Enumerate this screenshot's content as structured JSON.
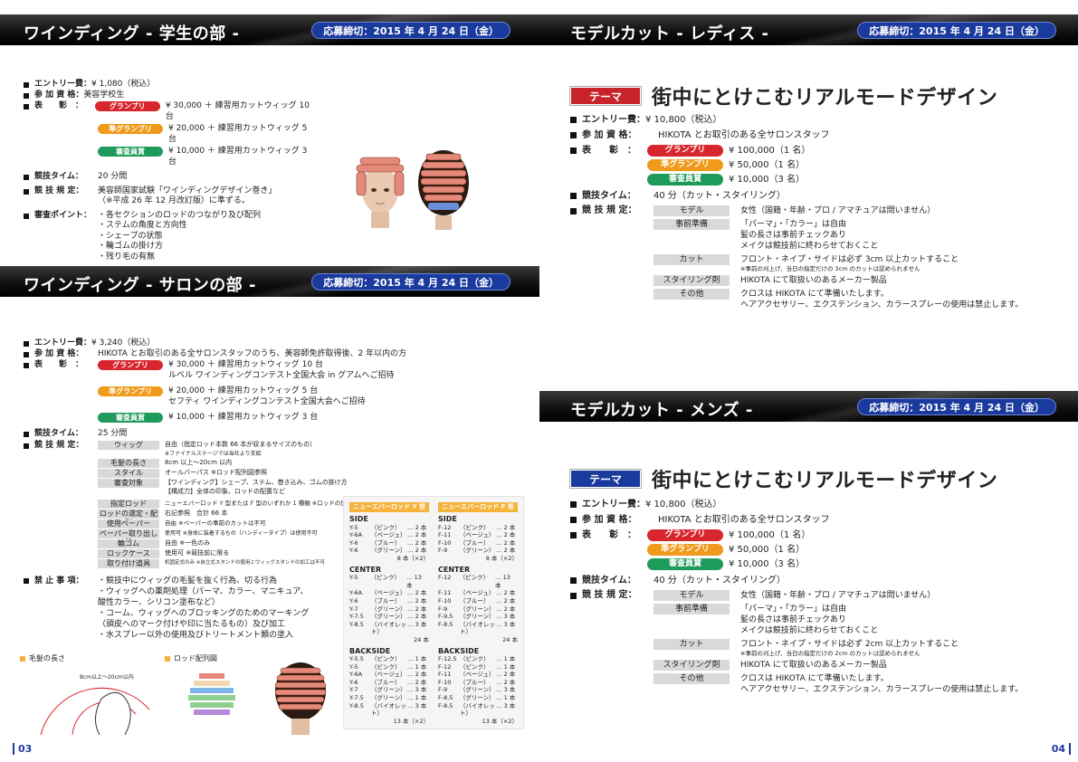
{
  "colors": {
    "grand": "#d8262e",
    "jun": "#f09a1c",
    "shinsa": "#1e9a5a",
    "deadline": "#1b3a9e",
    "theme_red": "#c8222a",
    "theme_blue": "#1b3a9e"
  },
  "deadline": "応募締切：2015 年 4 月 24 日（金）",
  "awards": {
    "grand": "グランプリ",
    "jun": "準グランプリ",
    "shinsa": "審査員賞"
  },
  "labels": {
    "entry": "エントリー費：",
    "qual": "参 加 資 格：",
    "award": "表　　彰　：",
    "time": "競技タイム：",
    "rules": "競 技 規 定：",
    "points": "審査ポイント：",
    "prohibit": "禁 止 事 項："
  },
  "student": {
    "title": "ワインディング - 学生の部 -",
    "entry": "¥ 1,080（税込）",
    "qual": "美容学校生",
    "prizes": [
      "¥ 30,000 ＋ 練習用カットウィッグ 10 台",
      "¥ 20,000 ＋ 練習用カットウィッグ 5 台",
      "¥ 10,000 ＋ 練習用カットウィッグ 3 台"
    ],
    "time": "20 分間",
    "rules": [
      "美容師国家試験「ワインディングデザイン巻き」",
      "（※平成 26 年 12 月改訂版）に準ずる。"
    ],
    "points": [
      "・各セクションのロッドのつながり及び配列",
      "・ステムの角度と方向性",
      "・シェープの状態",
      "・輪ゴムの掛け方",
      "・残り毛の有無"
    ]
  },
  "salon": {
    "title": "ワインディング - サロンの部 -",
    "entry": "¥ 3,240（税込）",
    "qual": "HIKOTA とお取引のある全サロンスタッフのうち、美容師免許取得後、2 年以内の方",
    "prize1": [
      "¥ 30,000 ＋ 練習用カットウィッグ 10 台",
      "ルベル ワインディングコンテスト全国大会 in グアムへご招待"
    ],
    "prize2": [
      "¥ 20,000 ＋ 練習用カットウィッグ 5 台",
      "セフティ ワインディングコンテスト全国大会へご招待"
    ],
    "prize3": "¥ 10,000 ＋ 練習用カットウィッグ 3 台",
    "time": "25 分間",
    "rules": [
      {
        "k": "ウィッグ",
        "v": "自由（指定ロッド本数 66 本が収まるサイズのもの）",
        "n": "※ファイナルステージでは当社より支給"
      },
      {
        "k": "毛髪の長さ",
        "v": "8cm 以上〜20cm 以内",
        "n": ""
      },
      {
        "k": "スタイル",
        "v": "オールバーパス ※ロッド配列図参照",
        "n": ""
      },
      {
        "k": "審査対象",
        "v": "【ワインディング】シェープ、ステム、巻き込み、ゴムの掛け方",
        "n": "【構成力】全体の印象、ロッドの配置など"
      },
      {
        "k": "指定ロッド",
        "v": "ニューエバーロッド Y 型または F 型のいずれか 1 種類 ※ロッドの加工禁止",
        "n": ""
      },
      {
        "k": "ロッドの選定・配列",
        "v": "右記参照　合計 66 本",
        "n": ""
      },
      {
        "k": "使用ペーパー",
        "v": "自由 ※ペーパーの事前のカットは不可",
        "n": ""
      },
      {
        "k": "ペーパー取り出し器",
        "v": "使用可 ※身体に装着するもの（ハンディータイプ）は使用不可",
        "n": ""
      },
      {
        "k": "輪ゴム",
        "v": "自由 ※一色のみ",
        "n": ""
      },
      {
        "k": "ロックケース",
        "v": "使用可 ※競技前に限る",
        "n": ""
      },
      {
        "k": "取り付け道具",
        "v": "机固定式のみ ※自立式スタンドの使用とウィッグスタンドの加工は不可",
        "n": ""
      }
    ],
    "prohibit": [
      "・競技中にウィッグの毛髪を抜く行為、切る行為",
      "・ウィッグへの薬剤処理（パーマ、カラー、マニキュア、",
      "酸性カラー、シリコン塗布など）",
      "・コーム、ウィッグへのブロッキングのためのマーキング",
      "（頭皮へのマーク付けや印に当たるもの）及び加工",
      "・水スプレー以外の使用及びトリートメント類の塗入"
    ],
    "fig1": "毛髪の長さ",
    "fig1_text": "8cm以上〜20cm以内",
    "fig2": "ロッド配列図"
  },
  "rods": {
    "y": {
      "title": "ニューエバーロッド Y 型",
      "side": [
        [
          "Y-5",
          "（ピンク）",
          "… 2 本"
        ],
        [
          "Y-6A",
          "（ベージュ）",
          "… 2 本"
        ],
        [
          "Y-6",
          "（ブルー）",
          "… 2 本"
        ],
        [
          "Y-6",
          "（グリーン）",
          "… 2 本"
        ]
      ],
      "side_total": "8 本（×2）",
      "center": [
        [
          "Y-5",
          "（ピンク）",
          "… 13 本"
        ],
        [
          "Y-6A",
          "（ベージュ）",
          "… 2 本"
        ],
        [
          "Y-6",
          "（ブルー）",
          "… 2 本"
        ],
        [
          "Y-7",
          "（グリーン）",
          "… 2 本"
        ],
        [
          "Y-7.5",
          "（グリーン）",
          "… 2 本"
        ],
        [
          "Y-8.5",
          "（バイオレット）",
          "… 3 本"
        ]
      ],
      "center_total": "24 本",
      "back": [
        [
          "Y-5.5",
          "（ピンク）",
          "… 1 本"
        ],
        [
          "Y-5",
          "（ピンク）",
          "… 1 本"
        ],
        [
          "Y-6A",
          "（ベージュ）",
          "… 2 本"
        ],
        [
          "Y-6",
          "（ブルー）",
          "… 2 本"
        ],
        [
          "Y-7",
          "（グリーン）",
          "… 3 本"
        ],
        [
          "Y-7.5",
          "（グリーン）",
          "… 1 本"
        ],
        [
          "Y-8.5",
          "（バイオレット）",
          "… 3 本"
        ]
      ],
      "back_total": "13 本（×2）"
    },
    "f": {
      "title": "ニューエバーロッド F 型",
      "side": [
        [
          "F-12",
          "（ピンク）",
          "… 2 本"
        ],
        [
          "F-11",
          "（ベージュ）",
          "… 2 本"
        ],
        [
          "F-10",
          "（ブルー）",
          "… 2 本"
        ],
        [
          "F-9",
          "（グリーン）",
          "… 2 本"
        ]
      ],
      "side_total": "8 本（×2）",
      "center": [
        [
          "F-12",
          "（ピンク）",
          "… 13 本"
        ],
        [
          "F-11",
          "（ベージュ）",
          "… 2 本"
        ],
        [
          "F-10",
          "（ブルー）",
          "… 2 本"
        ],
        [
          "F-9",
          "（グリーン）",
          "… 2 本"
        ],
        [
          "F-9.5",
          "（グリーン）",
          "… 3 本"
        ],
        [
          "F-8.5",
          "（バイオレット）",
          "… 3 本"
        ]
      ],
      "center_total": "24 本",
      "back": [
        [
          "F-12.5",
          "（ピンク）",
          "… 1 本"
        ],
        [
          "F-12",
          "（ピンク）",
          "… 1 本"
        ],
        [
          "F-11",
          "（ベージュ）",
          "… 2 本"
        ],
        [
          "F-10",
          "（ブルー）",
          "… 2 本"
        ],
        [
          "F-9",
          "（グリーン）",
          "… 3 本"
        ],
        [
          "F-8.5",
          "（グリーン）",
          "… 1 本"
        ],
        [
          "F-8.5",
          "（バイオレット）",
          "… 3 本"
        ]
      ],
      "back_total": "13 本（×2）"
    },
    "side": "SIDE",
    "center": "CENTER",
    "back": "BACKSIDE"
  },
  "ladies": {
    "title": "モデルカット - レディス -",
    "theme_tag": "テーマ",
    "theme": "街中にとけこむリアルモードデザイン",
    "entry": "¥ 10,800（税込）",
    "qual": "HIKOTA とお取引のある全サロンスタッフ",
    "prizes": [
      "¥ 100,000（1 名）",
      "¥ 50,000（1 名）",
      "¥ 10,000（3 名）"
    ],
    "time": "40 分（カット・スタイリング）",
    "rules": [
      {
        "k": "モデル",
        "v": [
          "女性（国籍・年齢・プロ / アマチュアは問いません）"
        ]
      },
      {
        "k": "事前準備",
        "v": [
          "「パーマ」・「カラー」は自由",
          "髪の長さは事前チェックあり",
          "メイクは競技前に終わらせておくこと"
        ]
      },
      {
        "k": "カット",
        "v": [
          "フロント・ネイプ・サイドは必ず 3cm 以上カットすること"
        ],
        "n": "※事前の刈上げ、当日の指定だけの 3cm のカットは認められません"
      },
      {
        "k": "スタイリング剤",
        "v": [
          "HIKOTA にて取扱いのあるメーカー製品"
        ]
      },
      {
        "k": "その他",
        "v": [
          "クロスは HIKOTA にて準備いたします。",
          "ヘアアクセサリー、エクステンション、カラースプレーの使用は禁止します。"
        ]
      }
    ]
  },
  "mens": {
    "title": "モデルカット - メンズ -",
    "theme_tag": "テーマ",
    "theme": "街中にとけこむリアルモードデザイン",
    "entry": "¥ 10,800（税込）",
    "qual": "HIKOTA とお取引のある全サロンスタッフ",
    "prizes": [
      "¥ 100,000（1 名）",
      "¥ 50,000（1 名）",
      "¥ 10,000（3 名）"
    ],
    "time": "40 分（カット・スタイリング）",
    "rules": [
      {
        "k": "モデル",
        "v": [
          "女性（国籍・年齢・プロ / アマチュアは問いません）"
        ]
      },
      {
        "k": "事前準備",
        "v": [
          "「パーマ」・「カラー」は自由",
          "髪の長さは事前チェックあり",
          "メイクは競技前に終わらせておくこと"
        ]
      },
      {
        "k": "カット",
        "v": [
          "フロント・ネイプ・サイドは必ず 2cm 以上カットすること"
        ],
        "n": "※事前の刈上げ、当日の指定だけの 2cm のカットは認められません"
      },
      {
        "k": "スタイリング剤",
        "v": [
          "HIKOTA にて取扱いのあるメーカー製品"
        ]
      },
      {
        "k": "その他",
        "v": [
          "クロスは HIKOTA にて準備いたします。",
          "ヘアアクセサリー、エクステンション、カラースプレーの使用は禁止します。"
        ]
      }
    ]
  },
  "pages": {
    "left": "03",
    "right": "04"
  }
}
